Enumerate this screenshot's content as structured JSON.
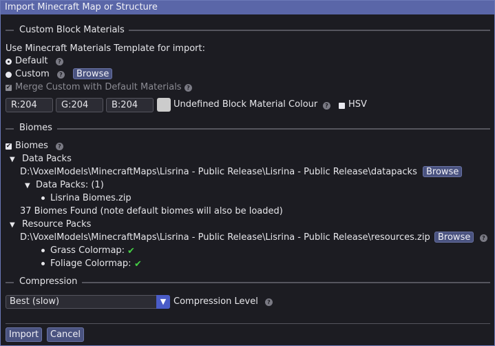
{
  "window": {
    "title": "Import Minecraft Map or Structure"
  },
  "materials": {
    "section_label": "Custom Block Materials",
    "template_label": "Use Minecraft Materials Template for import:",
    "default_label": "Default",
    "custom_label": "Custom",
    "browse_label": "Browse",
    "merge_label": "Merge Custom with Default Materials",
    "r_value": "R:204",
    "g_value": "G:204",
    "b_value": "B:204",
    "undefined_label": "Undefined Block Material Colour",
    "hsv_label": "HSV"
  },
  "biomes": {
    "section_label": "Biomes",
    "checkbox_label": "Biomes",
    "data_packs_label": "Data Packs",
    "data_packs_path": "D:\\VoxelModels\\MinecraftMaps\\Lisrina - Public Release\\Lisrina - Public Release\\datapacks",
    "data_packs_browse": "Browse",
    "data_packs_count_label": "Data Packs:  (1)",
    "data_pack_file": "Lisrina Biomes.zip",
    "found_text": "37 Biomes Found (note default biomes will also be loaded)",
    "resource_packs_label": "Resource Packs",
    "resource_packs_path": "D:\\VoxelModels\\MinecraftMaps\\Lisrina - Public Release\\Lisrina - Public Release\\resources.zip",
    "resource_packs_browse": "Browse",
    "grass_label": "Grass Colormap:",
    "foliage_label": "Foliage Colormap:"
  },
  "compression": {
    "section_label": "Compression",
    "selected": "Best (slow)",
    "level_label": "Compression Level"
  },
  "footer": {
    "import_label": "Import",
    "cancel_label": "Cancel"
  },
  "icons": {
    "help": "?",
    "checkmark": "✔",
    "tree_expanded": "▼",
    "dropdown_arrow": "▼"
  },
  "colors": {
    "title_bar": "#5a66a8",
    "button": "#4a5380",
    "combo_arrow": "#4a5cc8",
    "success_tick": "#45d045",
    "undefined_swatch": "#cccccc"
  }
}
